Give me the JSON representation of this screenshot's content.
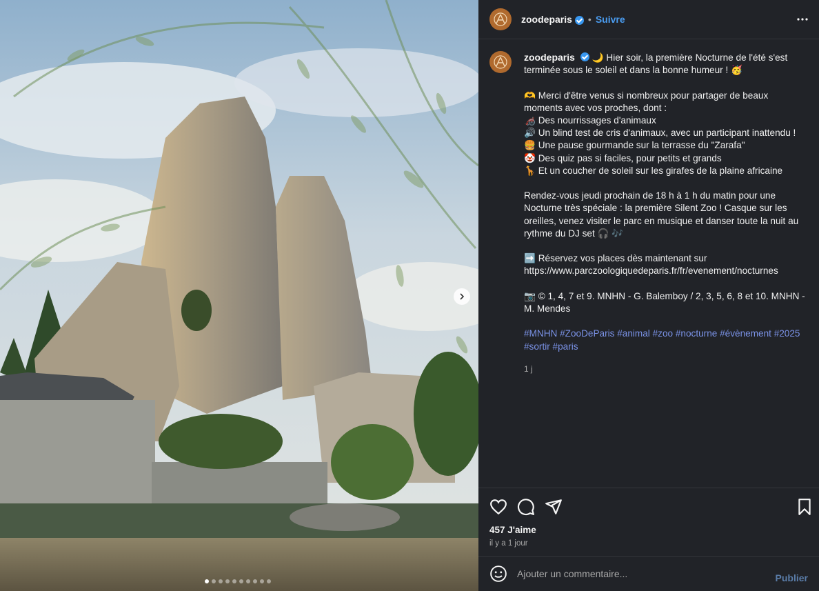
{
  "post": {
    "username": "zoodeparis",
    "sep": "•",
    "follow_label": "Suivre",
    "caption_lines": [
      "🌙 Hier soir, la première Nocturne de l'été s'est terminée sous le soleil et dans la bonne humeur ! 🥳",
      "",
      "🫶 Merci d'être venus si nombreux pour partager de beaux moments avec vos proches, dont :",
      "🦽 Des nourrissages d'animaux",
      "🔊 Un blind test de cris d'animaux, avec un participant inattendu !",
      "🍔 Une pause gourmande sur la terrasse du \"Zarafa\"",
      "🤡 Des quiz pas si faciles, pour petits et grands",
      "🦒 Et un coucher de soleil sur les girafes de la plaine africaine",
      "",
      "Rendez-vous jeudi prochain de 18 h à 1 h du matin pour une Nocturne très spéciale : la première Silent Zoo ! Casque sur les oreilles, venez visiter le parc en musique et danser toute la nuit au rythme du DJ set 🎧 🎶",
      "",
      "➡️ Réservez vos places dès maintenant sur https://www.parczoologiquedeparis.fr/fr/evenement/nocturnes",
      "",
      "📷 © 1, 4, 7 et 9. MNHN - G. Balemboy / 2, 3, 5, 6, 8 et 10. MNHN - M. Mendes"
    ],
    "hashtags": "#MNHN #ZooDeParis #animal #zoo #nocturne #évènement #2025 #sortir #paris",
    "caption_time": "1 j",
    "likes": "457 J'aime",
    "ago": "il y a 1 jour",
    "comment_placeholder": "Ajouter un commentaire...",
    "publish_label": "Publier",
    "carousel_count": 10,
    "carousel_active": 0
  },
  "icons": {
    "more": "more-icon",
    "like": "heart-icon",
    "comment": "comment-icon",
    "share": "send-icon",
    "save": "bookmark-icon",
    "next": "chevron-right-icon",
    "emoji": "smiley-icon"
  },
  "colors": {
    "panel_bg": "#212328",
    "link": "#4a9cf0",
    "hashtag": "#7b93e8",
    "verified": "#3897f0"
  }
}
